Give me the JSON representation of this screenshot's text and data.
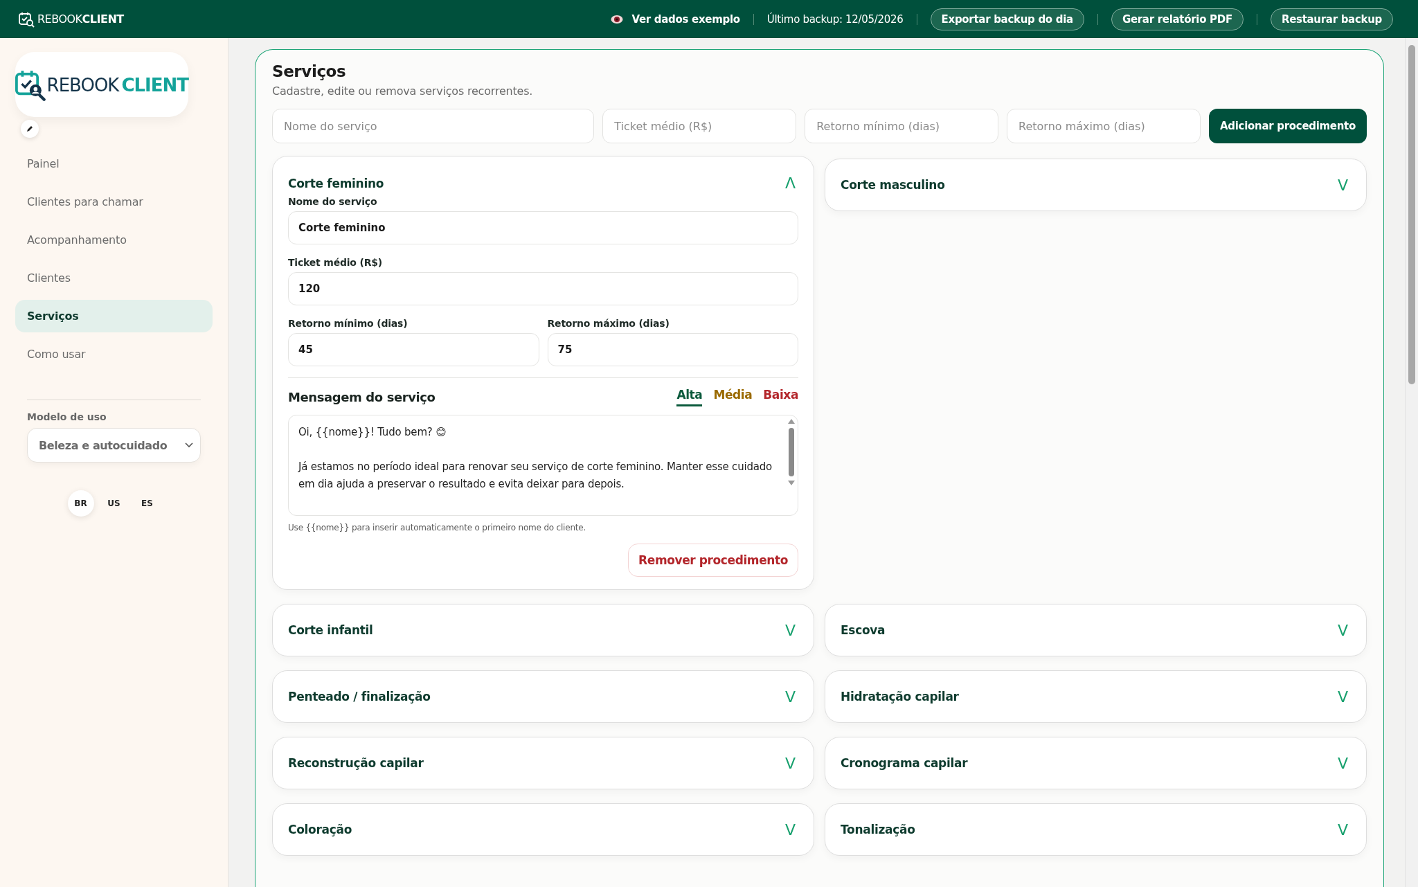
{
  "topbar": {
    "brand": {
      "light": "REBOOK",
      "bold": "CLIENT"
    },
    "demo_link": "Ver dados exemplo",
    "last_backup": "Último backup: 12/05/2026",
    "buttons": [
      "Exportar backup do dia",
      "Gerar relatório PDF",
      "Restaurar backup"
    ]
  },
  "sidebar": {
    "brand": {
      "light": "REBOOK",
      "bold": "CLIENT"
    },
    "items": [
      {
        "label": "Painel",
        "selected": false
      },
      {
        "label": "Clientes para chamar",
        "selected": false
      },
      {
        "label": "Acompanhamento",
        "selected": false
      },
      {
        "label": "Clientes",
        "selected": false
      },
      {
        "label": "Serviços",
        "selected": true
      },
      {
        "label": "Como usar",
        "selected": false
      }
    ],
    "usage_model": {
      "label": "Modelo de uso",
      "value": "Beleza e autocuidado"
    },
    "languages": [
      {
        "label": "BR",
        "selected": true
      },
      {
        "label": "US",
        "selected": false
      },
      {
        "label": "ES",
        "selected": false
      }
    ]
  },
  "page": {
    "title": "Serviços",
    "subtitle": "Cadastre, edite ou remova serviços recorrentes.",
    "new_service": {
      "fields": [
        {
          "placeholder": "Nome do serviço"
        },
        {
          "placeholder": "Ticket médio (R$)"
        },
        {
          "placeholder": "Retorno mínimo (dias)"
        },
        {
          "placeholder": "Retorno máximo (dias)"
        }
      ],
      "button": "Adicionar procedimento"
    },
    "services": [
      {
        "name": "Corte feminino",
        "expanded": true,
        "toggle": "Λ",
        "details": {
          "fields": [
            {
              "label": "Nome do serviço",
              "value": "Corte feminino"
            },
            {
              "label": "Ticket médio (R$)",
              "value": "120"
            },
            {
              "label": "Retorno mínimo (dias)",
              "value": "45"
            },
            {
              "label": "Retorno máximo (dias)",
              "value": "75"
            }
          ],
          "message_label": "Mensagem do serviço",
          "priorities": [
            {
              "label": "Alta",
              "selected": true,
              "color": "#0b5a3c"
            },
            {
              "label": "Média",
              "selected": false,
              "color": "#9a6a00"
            },
            {
              "label": "Baixa",
              "selected": false,
              "color": "#b3262b"
            }
          ],
          "message": "Oi, {{nome}}! Tudo bem? 😊\n\nJá estamos no período ideal para renovar seu serviço de corte feminino. Manter esse cuidado em dia ajuda a preservar o resultado e evita deixar para depois.",
          "hint": "Use {{nome}} para inserir automaticamente o primeiro nome do cliente.",
          "remove_button": "Remover procedimento"
        }
      },
      {
        "name": "Corte masculino",
        "expanded": false,
        "toggle": "V"
      },
      {
        "name": "Corte infantil",
        "expanded": false,
        "toggle": "V"
      },
      {
        "name": "Escova",
        "expanded": false,
        "toggle": "V"
      },
      {
        "name": "Penteado / finalização",
        "expanded": false,
        "toggle": "V"
      },
      {
        "name": "Hidratação capilar",
        "expanded": false,
        "toggle": "V"
      },
      {
        "name": "Reconstrução capilar",
        "expanded": false,
        "toggle": "V"
      },
      {
        "name": "Cronograma capilar",
        "expanded": false,
        "toggle": "V"
      },
      {
        "name": "Coloração",
        "expanded": false,
        "toggle": "V"
      },
      {
        "name": "Tonalização",
        "expanded": false,
        "toggle": "V"
      }
    ]
  }
}
